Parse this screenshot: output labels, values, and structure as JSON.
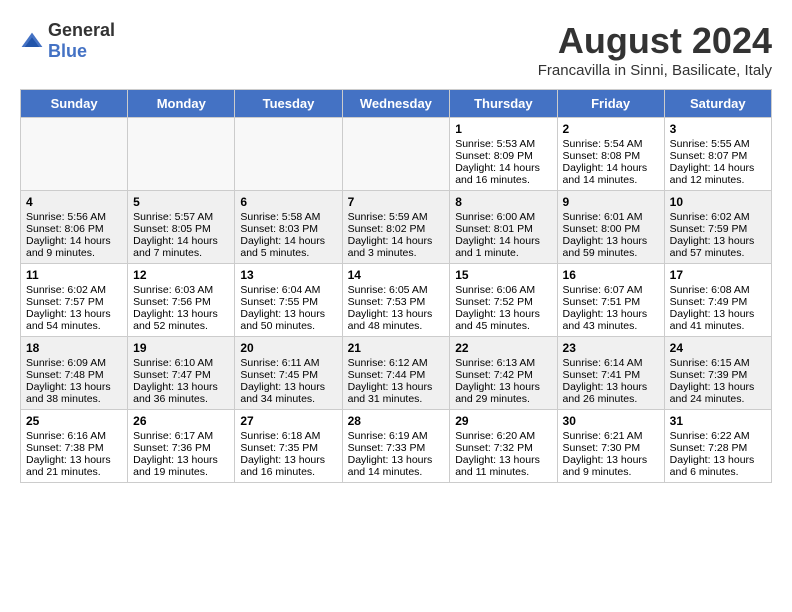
{
  "header": {
    "logo_general": "General",
    "logo_blue": "Blue",
    "title": "August 2024",
    "subtitle": "Francavilla in Sinni, Basilicate, Italy"
  },
  "calendar": {
    "days_of_week": [
      "Sunday",
      "Monday",
      "Tuesday",
      "Wednesday",
      "Thursday",
      "Friday",
      "Saturday"
    ],
    "weeks": [
      {
        "shaded": false,
        "days": [
          {
            "num": "",
            "content": ""
          },
          {
            "num": "",
            "content": ""
          },
          {
            "num": "",
            "content": ""
          },
          {
            "num": "",
            "content": ""
          },
          {
            "num": "1",
            "content": "Sunrise: 5:53 AM\nSunset: 8:09 PM\nDaylight: 14 hours\nand 16 minutes."
          },
          {
            "num": "2",
            "content": "Sunrise: 5:54 AM\nSunset: 8:08 PM\nDaylight: 14 hours\nand 14 minutes."
          },
          {
            "num": "3",
            "content": "Sunrise: 5:55 AM\nSunset: 8:07 PM\nDaylight: 14 hours\nand 12 minutes."
          }
        ]
      },
      {
        "shaded": true,
        "days": [
          {
            "num": "4",
            "content": "Sunrise: 5:56 AM\nSunset: 8:06 PM\nDaylight: 14 hours\nand 9 minutes."
          },
          {
            "num": "5",
            "content": "Sunrise: 5:57 AM\nSunset: 8:05 PM\nDaylight: 14 hours\nand 7 minutes."
          },
          {
            "num": "6",
            "content": "Sunrise: 5:58 AM\nSunset: 8:03 PM\nDaylight: 14 hours\nand 5 minutes."
          },
          {
            "num": "7",
            "content": "Sunrise: 5:59 AM\nSunset: 8:02 PM\nDaylight: 14 hours\nand 3 minutes."
          },
          {
            "num": "8",
            "content": "Sunrise: 6:00 AM\nSunset: 8:01 PM\nDaylight: 14 hours\nand 1 minute."
          },
          {
            "num": "9",
            "content": "Sunrise: 6:01 AM\nSunset: 8:00 PM\nDaylight: 13 hours\nand 59 minutes."
          },
          {
            "num": "10",
            "content": "Sunrise: 6:02 AM\nSunset: 7:59 PM\nDaylight: 13 hours\nand 57 minutes."
          }
        ]
      },
      {
        "shaded": false,
        "days": [
          {
            "num": "11",
            "content": "Sunrise: 6:02 AM\nSunset: 7:57 PM\nDaylight: 13 hours\nand 54 minutes."
          },
          {
            "num": "12",
            "content": "Sunrise: 6:03 AM\nSunset: 7:56 PM\nDaylight: 13 hours\nand 52 minutes."
          },
          {
            "num": "13",
            "content": "Sunrise: 6:04 AM\nSunset: 7:55 PM\nDaylight: 13 hours\nand 50 minutes."
          },
          {
            "num": "14",
            "content": "Sunrise: 6:05 AM\nSunset: 7:53 PM\nDaylight: 13 hours\nand 48 minutes."
          },
          {
            "num": "15",
            "content": "Sunrise: 6:06 AM\nSunset: 7:52 PM\nDaylight: 13 hours\nand 45 minutes."
          },
          {
            "num": "16",
            "content": "Sunrise: 6:07 AM\nSunset: 7:51 PM\nDaylight: 13 hours\nand 43 minutes."
          },
          {
            "num": "17",
            "content": "Sunrise: 6:08 AM\nSunset: 7:49 PM\nDaylight: 13 hours\nand 41 minutes."
          }
        ]
      },
      {
        "shaded": true,
        "days": [
          {
            "num": "18",
            "content": "Sunrise: 6:09 AM\nSunset: 7:48 PM\nDaylight: 13 hours\nand 38 minutes."
          },
          {
            "num": "19",
            "content": "Sunrise: 6:10 AM\nSunset: 7:47 PM\nDaylight: 13 hours\nand 36 minutes."
          },
          {
            "num": "20",
            "content": "Sunrise: 6:11 AM\nSunset: 7:45 PM\nDaylight: 13 hours\nand 34 minutes."
          },
          {
            "num": "21",
            "content": "Sunrise: 6:12 AM\nSunset: 7:44 PM\nDaylight: 13 hours\nand 31 minutes."
          },
          {
            "num": "22",
            "content": "Sunrise: 6:13 AM\nSunset: 7:42 PM\nDaylight: 13 hours\nand 29 minutes."
          },
          {
            "num": "23",
            "content": "Sunrise: 6:14 AM\nSunset: 7:41 PM\nDaylight: 13 hours\nand 26 minutes."
          },
          {
            "num": "24",
            "content": "Sunrise: 6:15 AM\nSunset: 7:39 PM\nDaylight: 13 hours\nand 24 minutes."
          }
        ]
      },
      {
        "shaded": false,
        "days": [
          {
            "num": "25",
            "content": "Sunrise: 6:16 AM\nSunset: 7:38 PM\nDaylight: 13 hours\nand 21 minutes."
          },
          {
            "num": "26",
            "content": "Sunrise: 6:17 AM\nSunset: 7:36 PM\nDaylight: 13 hours\nand 19 minutes."
          },
          {
            "num": "27",
            "content": "Sunrise: 6:18 AM\nSunset: 7:35 PM\nDaylight: 13 hours\nand 16 minutes."
          },
          {
            "num": "28",
            "content": "Sunrise: 6:19 AM\nSunset: 7:33 PM\nDaylight: 13 hours\nand 14 minutes."
          },
          {
            "num": "29",
            "content": "Sunrise: 6:20 AM\nSunset: 7:32 PM\nDaylight: 13 hours\nand 11 minutes."
          },
          {
            "num": "30",
            "content": "Sunrise: 6:21 AM\nSunset: 7:30 PM\nDaylight: 13 hours\nand 9 minutes."
          },
          {
            "num": "31",
            "content": "Sunrise: 6:22 AM\nSunset: 7:28 PM\nDaylight: 13 hours\nand 6 minutes."
          }
        ]
      }
    ]
  }
}
